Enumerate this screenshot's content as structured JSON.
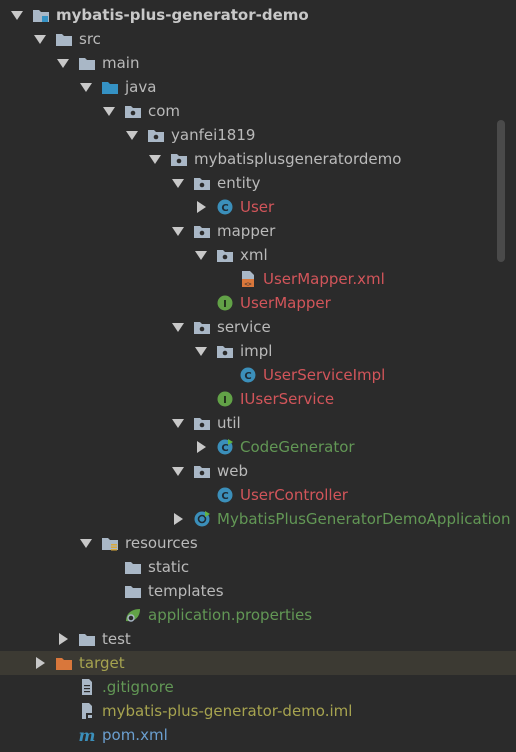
{
  "tree": [
    {
      "label": "mybatis-plus-generator-demo",
      "depth": 0,
      "expanded": true,
      "icon": "module-folder-icon",
      "color": "bold",
      "name": "tree-item-project-root"
    },
    {
      "label": "src",
      "depth": 1,
      "expanded": true,
      "icon": "folder-icon",
      "color": "default",
      "name": "tree-item-src"
    },
    {
      "label": "main",
      "depth": 2,
      "expanded": true,
      "icon": "folder-icon",
      "color": "default",
      "name": "tree-item-main"
    },
    {
      "label": "java",
      "depth": 3,
      "expanded": true,
      "icon": "source-folder-icon",
      "color": "default",
      "name": "tree-item-java"
    },
    {
      "label": "com",
      "depth": 4,
      "expanded": true,
      "icon": "package-icon",
      "color": "default",
      "name": "tree-item-com"
    },
    {
      "label": "yanfei1819",
      "depth": 5,
      "expanded": true,
      "icon": "package-icon",
      "color": "default",
      "name": "tree-item-yanfei1819"
    },
    {
      "label": "mybatisplusgeneratordemo",
      "depth": 6,
      "expanded": true,
      "icon": "package-icon",
      "color": "default",
      "name": "tree-item-mybatisplusgeneratordemo"
    },
    {
      "label": "entity",
      "depth": 7,
      "expanded": true,
      "icon": "package-icon",
      "color": "default",
      "name": "tree-item-entity"
    },
    {
      "label": "User",
      "depth": 8,
      "expanded": false,
      "icon": "class-icon",
      "color": "red",
      "name": "tree-item-user"
    },
    {
      "label": "mapper",
      "depth": 7,
      "expanded": true,
      "icon": "package-icon",
      "color": "default",
      "name": "tree-item-mapper"
    },
    {
      "label": "xml",
      "depth": 8,
      "expanded": true,
      "icon": "package-icon",
      "color": "default",
      "name": "tree-item-xml"
    },
    {
      "label": "UserMapper.xml",
      "depth": 9,
      "icon": "xml-file-icon",
      "color": "red",
      "name": "tree-item-usermapper-xml"
    },
    {
      "label": "UserMapper",
      "depth": 8,
      "icon": "interface-icon",
      "color": "red",
      "name": "tree-item-usermapper"
    },
    {
      "label": "service",
      "depth": 7,
      "expanded": true,
      "icon": "package-icon",
      "color": "default",
      "name": "tree-item-service"
    },
    {
      "label": "impl",
      "depth": 8,
      "expanded": true,
      "icon": "package-icon",
      "color": "default",
      "name": "tree-item-impl"
    },
    {
      "label": "UserServiceImpl",
      "depth": 9,
      "icon": "class-icon",
      "color": "red",
      "name": "tree-item-userserviceimpl"
    },
    {
      "label": "IUserService",
      "depth": 8,
      "icon": "interface-icon",
      "color": "red",
      "name": "tree-item-iuserservice"
    },
    {
      "label": "util",
      "depth": 7,
      "expanded": true,
      "icon": "package-icon",
      "color": "default",
      "name": "tree-item-util"
    },
    {
      "label": "CodeGenerator",
      "depth": 8,
      "expanded": false,
      "icon": "runnable-class-icon",
      "color": "green",
      "name": "tree-item-codegenerator"
    },
    {
      "label": "web",
      "depth": 7,
      "expanded": true,
      "icon": "package-icon",
      "color": "default",
      "name": "tree-item-web"
    },
    {
      "label": "UserController",
      "depth": 8,
      "icon": "class-icon",
      "color": "red",
      "name": "tree-item-usercontroller"
    },
    {
      "label": "MybatisPlusGeneratorDemoApplication",
      "depth": 7,
      "expanded": false,
      "icon": "spring-boot-class-icon",
      "color": "green",
      "name": "tree-item-application-class"
    },
    {
      "label": "resources",
      "depth": 3,
      "expanded": true,
      "icon": "resources-folder-icon",
      "color": "default",
      "name": "tree-item-resources"
    },
    {
      "label": "static",
      "depth": 4,
      "icon": "folder-icon",
      "color": "default",
      "name": "tree-item-static"
    },
    {
      "label": "templates",
      "depth": 4,
      "icon": "folder-icon",
      "color": "default",
      "name": "tree-item-templates"
    },
    {
      "label": "application.properties",
      "depth": 4,
      "icon": "spring-properties-icon",
      "color": "green",
      "name": "tree-item-application-properties"
    },
    {
      "label": "test",
      "depth": 2,
      "expanded": false,
      "icon": "folder-icon",
      "color": "default",
      "name": "tree-item-test"
    },
    {
      "label": "target",
      "depth": 1,
      "expanded": false,
      "icon": "excluded-folder-icon",
      "color": "olive",
      "highlight": true,
      "name": "tree-item-target"
    },
    {
      "label": ".gitignore",
      "depth": 2,
      "icon": "text-file-icon",
      "color": "green",
      "name": "tree-item-gitignore"
    },
    {
      "label": "mybatis-plus-generator-demo.iml",
      "depth": 2,
      "icon": "iml-file-icon",
      "color": "olive",
      "name": "tree-item-iml"
    },
    {
      "label": "pom.xml",
      "depth": 2,
      "icon": "maven-icon",
      "color": "blue",
      "name": "tree-item-pom"
    }
  ],
  "colors": {
    "background": "#2b2b2b",
    "default_text": "#bababa",
    "modified_red": "#d2555a",
    "added_green": "#629755",
    "ignored_olive": "#a6a34f",
    "pom_blue": "#6b9fd0",
    "highlight_row": "#3c3a33"
  }
}
